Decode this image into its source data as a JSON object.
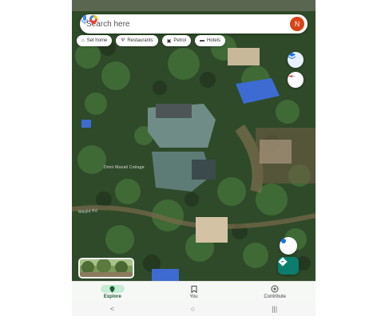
{
  "search": {
    "placeholder": "Search here",
    "avatar_letter": "N"
  },
  "chips": [
    {
      "icon": "home-icon",
      "label": "Set home"
    },
    {
      "icon": "restaurant-icon",
      "label": "Restaurants"
    },
    {
      "icon": "fuel-icon",
      "label": "Petrol"
    },
    {
      "icon": "hotel-icon",
      "label": "Hotels"
    }
  ],
  "map_labels": {
    "place": "Dimri Manali Cottage",
    "road": "Masjid Rd"
  },
  "nav": [
    {
      "label": "Explore",
      "icon": "explore-pin-icon",
      "active": true
    },
    {
      "label": "You",
      "icon": "bookmark-icon",
      "active": false
    },
    {
      "label": "Contribute",
      "icon": "plus-circle-icon",
      "active": false
    }
  ],
  "system_nav": {
    "back": "<",
    "home": "○",
    "recents": "|||"
  },
  "colors": {
    "accent": "#1a73e8",
    "active_pill": "#c7ecd5",
    "avatar": "#d84315",
    "directions_fab": "#0b7d6e"
  }
}
